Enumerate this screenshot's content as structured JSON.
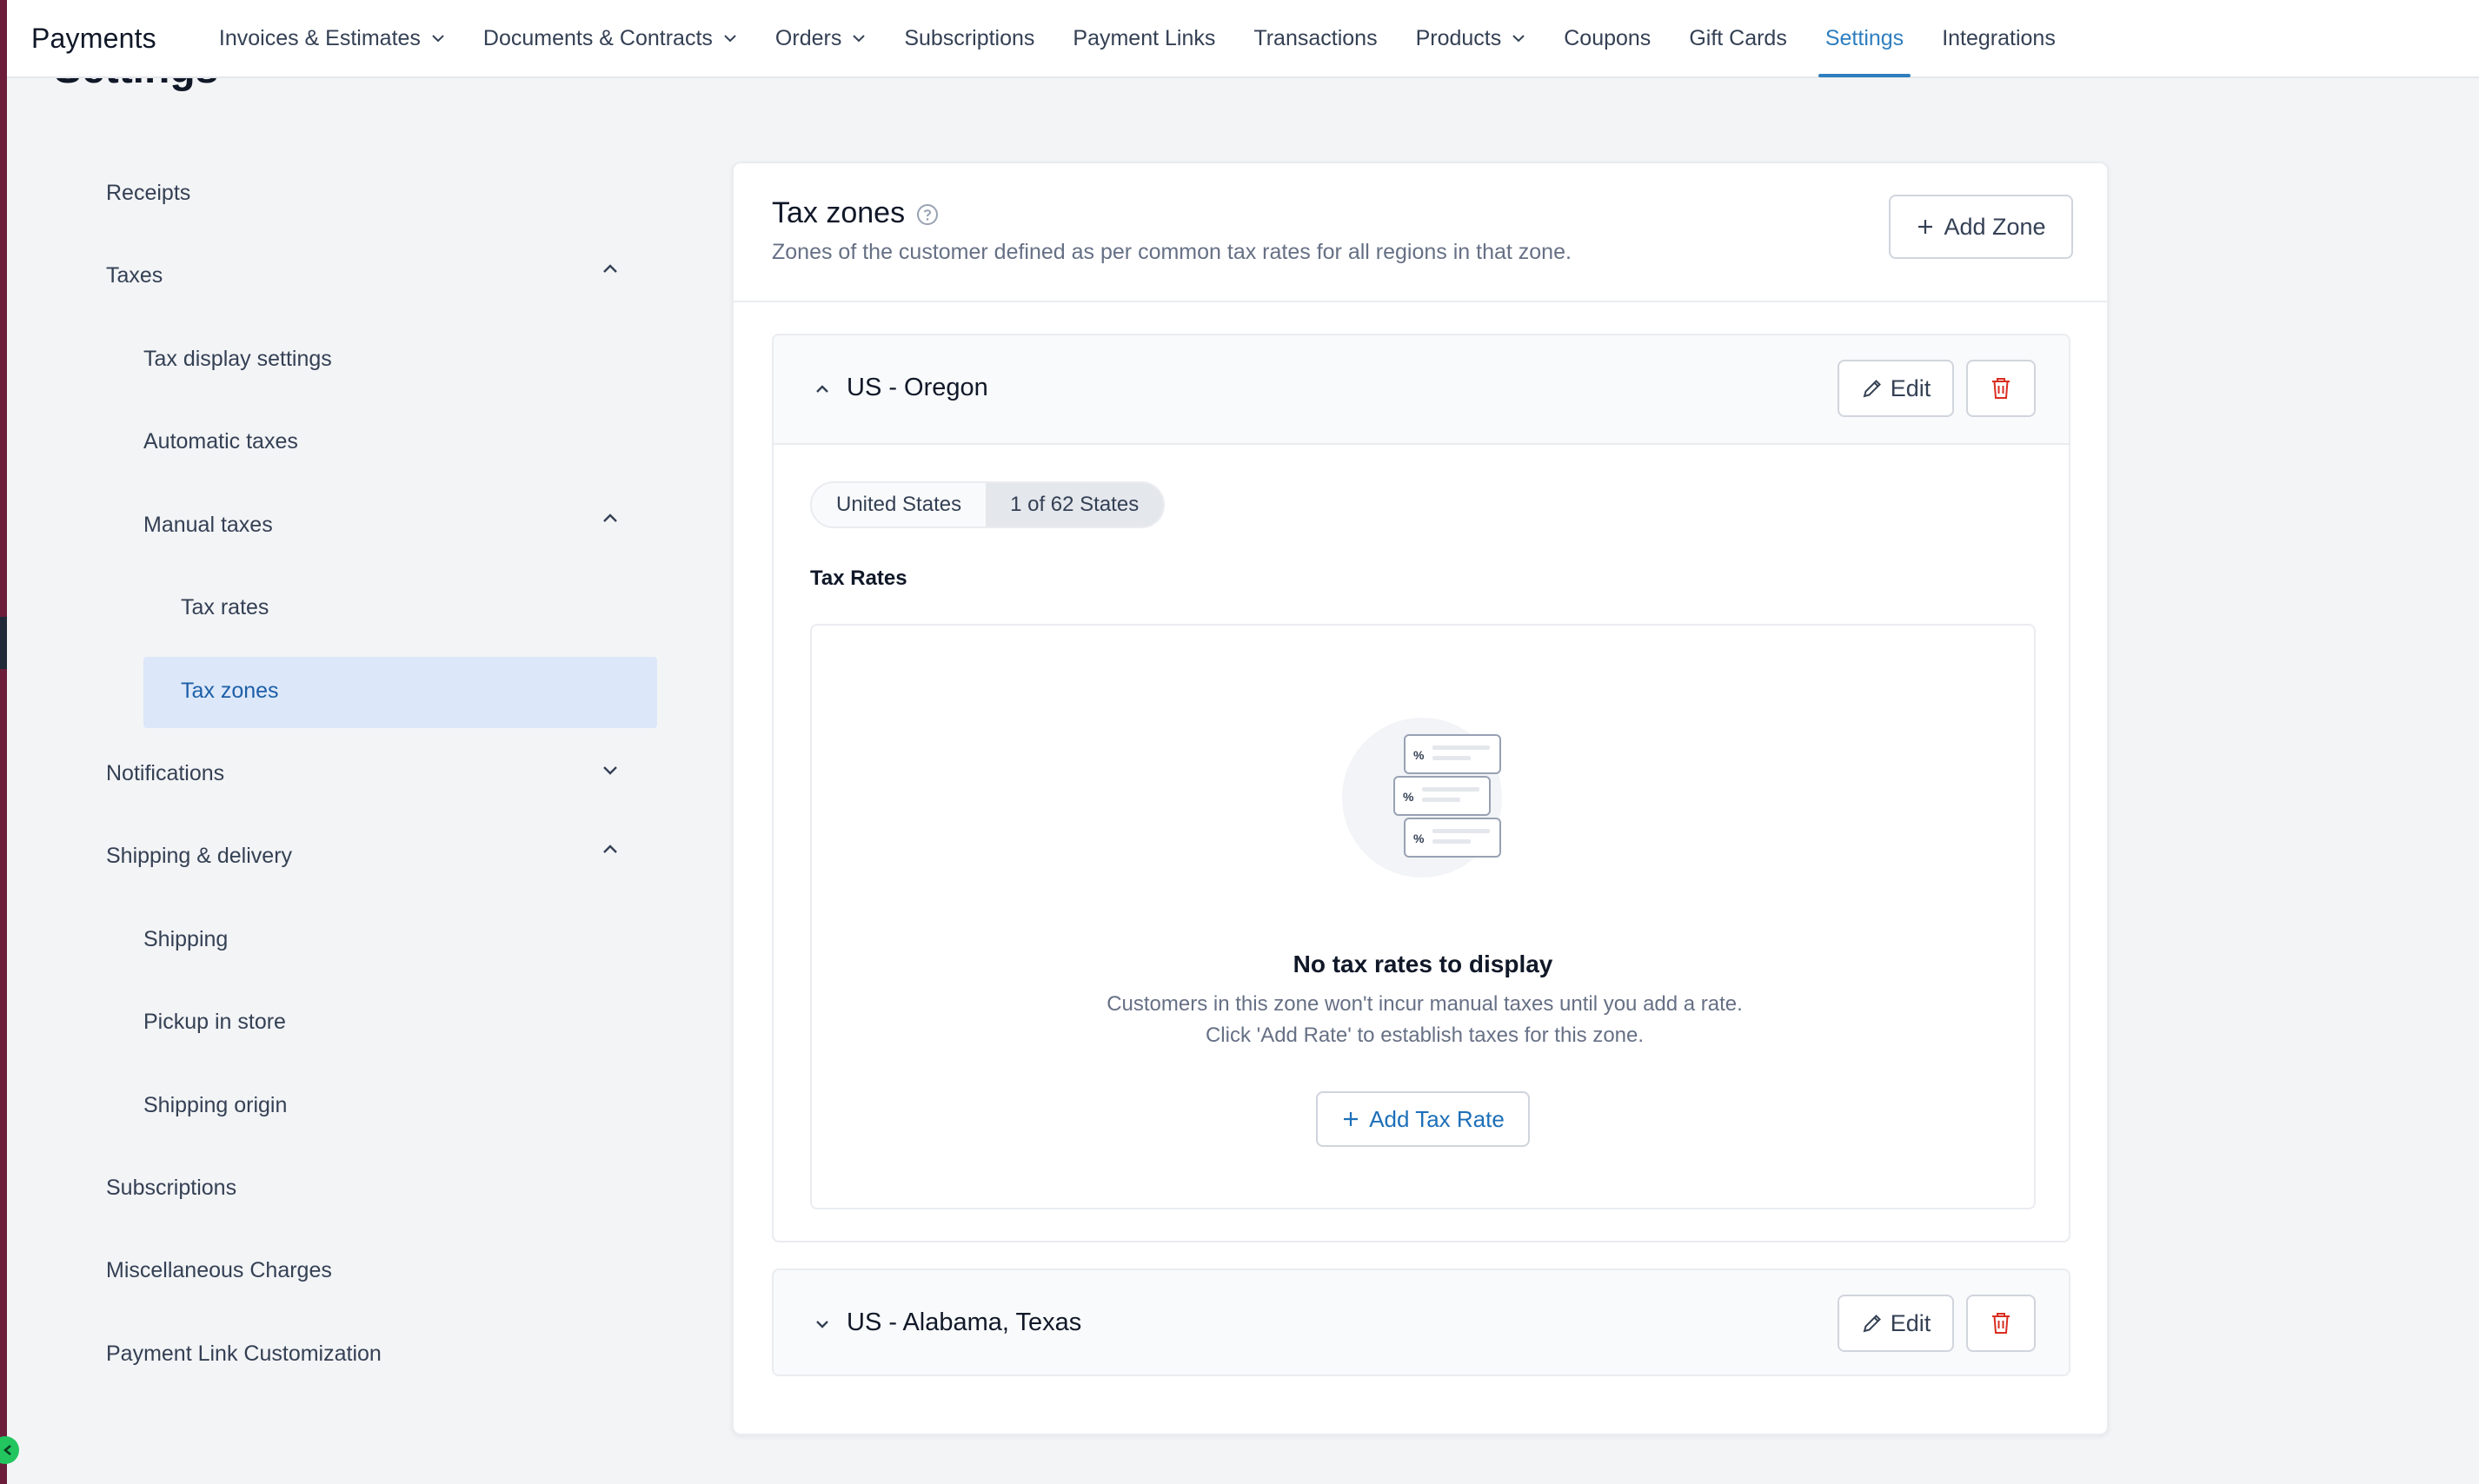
{
  "app": {
    "title": "Payments"
  },
  "nav": {
    "items": [
      {
        "label": "Invoices & Estimates",
        "dropdown": true
      },
      {
        "label": "Documents & Contracts",
        "dropdown": true
      },
      {
        "label": "Orders",
        "dropdown": true
      },
      {
        "label": "Subscriptions",
        "dropdown": false
      },
      {
        "label": "Payment Links",
        "dropdown": false
      },
      {
        "label": "Transactions",
        "dropdown": false
      },
      {
        "label": "Products",
        "dropdown": true
      },
      {
        "label": "Coupons",
        "dropdown": false
      },
      {
        "label": "Gift Cards",
        "dropdown": false
      },
      {
        "label": "Settings",
        "dropdown": false,
        "active": true
      },
      {
        "label": "Integrations",
        "dropdown": false
      }
    ]
  },
  "page": {
    "heading": "Settings"
  },
  "sidebar": {
    "items": [
      {
        "label": "Receipts"
      },
      {
        "label": "Taxes",
        "icon": "chevron-up-icon"
      },
      {
        "label": "Tax display settings"
      },
      {
        "label": "Automatic taxes"
      },
      {
        "label": "Manual taxes",
        "icon": "chevron-up-icon"
      },
      {
        "label": "Tax rates"
      },
      {
        "label": "Tax zones",
        "active": true
      },
      {
        "label": "Notifications",
        "icon": "chevron-down-icon"
      },
      {
        "label": "Shipping & delivery",
        "icon": "chevron-up-icon"
      },
      {
        "label": "Shipping"
      },
      {
        "label": "Pickup in store"
      },
      {
        "label": "Shipping origin"
      },
      {
        "label": "Subscriptions"
      },
      {
        "label": "Miscellaneous Charges"
      },
      {
        "label": "Payment Link Customization"
      }
    ]
  },
  "main": {
    "title": "Tax zones",
    "subtitle": "Zones of the customer defined as per common tax rates for all regions in that zone.",
    "add_zone_label": "Add Zone",
    "zones": [
      {
        "name": "US - Oregon",
        "expanded": true,
        "edit_label": "Edit",
        "country_pill": "United States",
        "states_pill": "1 of 62 States",
        "tax_rates_label": "Tax Rates",
        "empty_title": "No tax rates to display",
        "empty_desc": "Customers in this zone won't incur manual taxes until you add a rate. Click 'Add Rate' to establish taxes for this zone.",
        "add_rate_label": "Add Tax Rate",
        "illustration_glyph": "%"
      },
      {
        "name": "US - Alabama, Texas",
        "expanded": false,
        "edit_label": "Edit"
      }
    ]
  },
  "colors": {
    "accent": "#2e7ebf",
    "danger": "#d92d20",
    "active_bg": "#dce8f9",
    "sidebar_strip": "#6b1d3a"
  }
}
